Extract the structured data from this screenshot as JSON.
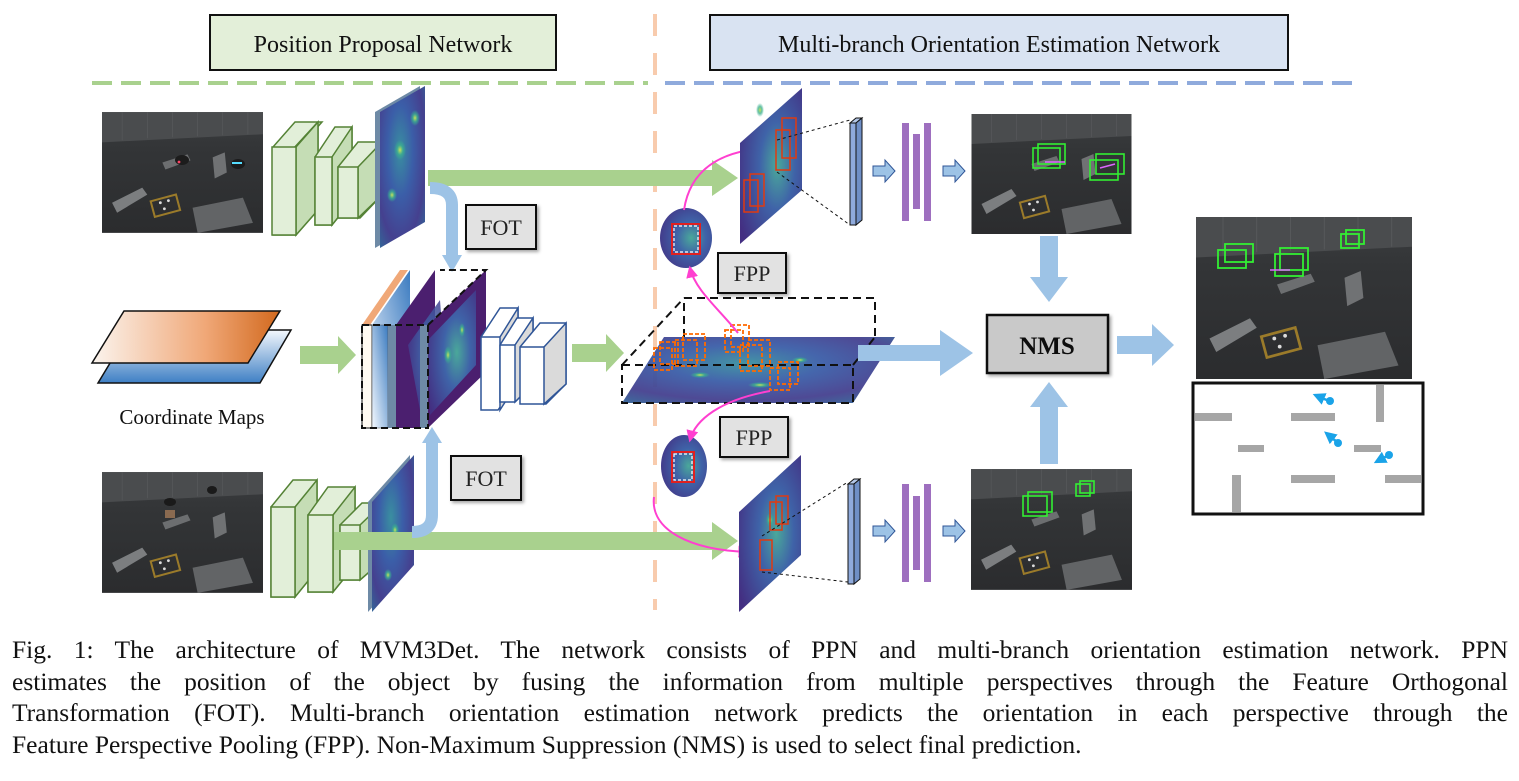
{
  "headers": {
    "left": "Position Proposal Network",
    "right": "Multi-branch Orientation Estimation Network"
  },
  "labels": {
    "fot_top": "FOT",
    "fot_bottom": "FOT",
    "fpp_top": "FPP",
    "fpp_bottom": "FPP",
    "nms": "NMS",
    "coordinate_maps": "Coordinate Maps"
  },
  "colors": {
    "ppn_header_bg": "#e3efd9",
    "moen_header_bg": "#d9e3f2",
    "green_arrow": "#a9d18e",
    "blue_arrow": "#9dc3e6",
    "divider_orange": "#f8cbad",
    "divider_green": "#a9d18e",
    "divider_blue": "#8faadc",
    "purple_block": "#9e6fbf",
    "magenta_curve": "#ff3fd0",
    "detection_green": "#33ee33",
    "map_wall_gray": "#a6a6a6",
    "map_robot_blue": "#1aa3e8",
    "nms_box_bg": "#c9c9c9"
  },
  "caption": {
    "lines": [
      "Fig. 1: The architecture of MVM3Det. The network consists of PPN and multi-branch orientation estimation network. PPN",
      "estimates the position of the object by fusing the information from multiple perspectives through the Feature Orthogonal",
      "Transformation (FOT). Multi-branch orientation estimation network predicts the orientation in each perspective through the",
      "Feature Perspective Pooling (FPP). Non-Maximum Suppression (NMS) is used to select final prediction."
    ]
  }
}
